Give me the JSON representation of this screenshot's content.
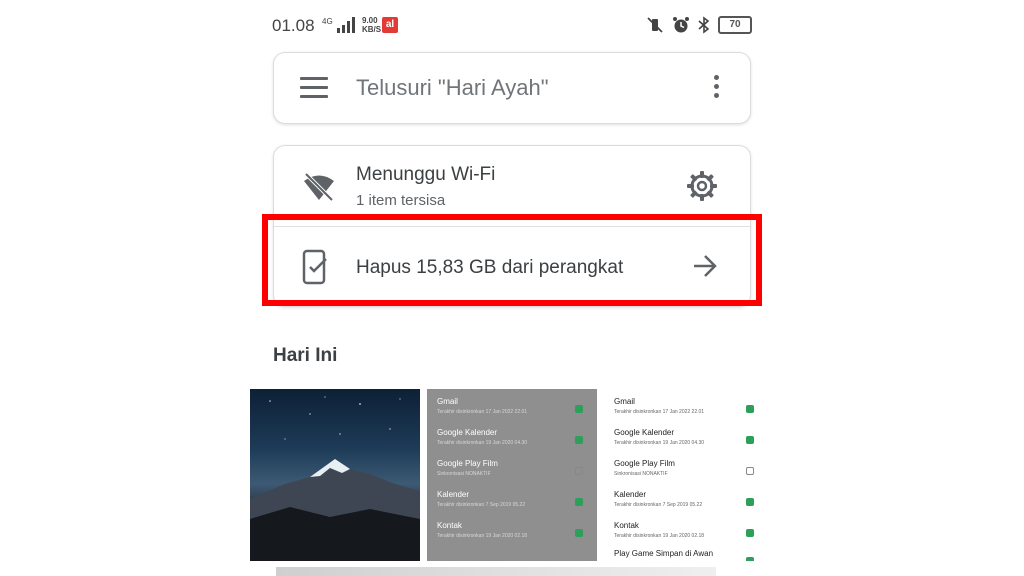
{
  "status_bar": {
    "time": "01.08",
    "network": "4G",
    "speed_value": "9.00",
    "speed_unit": "KB/S",
    "carrier": "al",
    "battery": "70"
  },
  "search": {
    "placeholder": "Telusuri \"Hari Ayah\""
  },
  "backup_card": {
    "wifi_title": "Menunggu Wi-Fi",
    "wifi_subtitle": "1 item tersisa",
    "free_up_label": "Hapus 15,83 GB dari perangkat"
  },
  "section": {
    "title": "Hari Ini"
  },
  "thumbnails": {
    "grey": [
      {
        "name": "Gmail",
        "date": "Terakhir disinkronkan 17 Jan 2022 22.01",
        "checked": true
      },
      {
        "name": "Google Kalender",
        "date": "Terakhir disinkronkan 19 Jan 2020 04.30",
        "checked": true
      },
      {
        "name": "Google Play Film",
        "date": "Sinkronisasi NONAKTIF",
        "checked": false
      },
      {
        "name": "Kalender",
        "date": "Terakhir disinkronkan 7 Sep 2019 05.22",
        "checked": true
      },
      {
        "name": "Kontak",
        "date": "Terakhir disinkronkan 19 Jan 2020 02.18",
        "checked": true
      }
    ],
    "white": [
      {
        "name": "Gmail",
        "date": "Terakhir disinkronkan 17 Jan 2022 22.01",
        "checked": true
      },
      {
        "name": "Google Kalender",
        "date": "Terakhir disinkronkan 19 Jan 2020 04.30",
        "checked": true
      },
      {
        "name": "Google Play Film",
        "date": "Sinkronisasi NONAKTIF",
        "checked": false
      },
      {
        "name": "Kalender",
        "date": "Terakhir disinkronkan 7 Sep 2019 05.22",
        "checked": true
      },
      {
        "name": "Kontak",
        "date": "Terakhir disinkronkan 19 Jan 2020 02.18",
        "checked": true
      },
      {
        "name": "Play Game Simpan di Awan",
        "date": "",
        "checked": true
      }
    ]
  },
  "colors": {
    "highlight": "#ff0000",
    "check_green": "#2e9e5b",
    "carrier_red": "#e53935"
  },
  "icons": [
    "menu-icon",
    "more-vert-icon",
    "wifi-off-icon",
    "settings-icon",
    "phone-check-icon",
    "arrow-right-icon",
    "mute-icon",
    "alarm-icon",
    "bluetooth-icon",
    "battery-icon",
    "signal-icon"
  ]
}
